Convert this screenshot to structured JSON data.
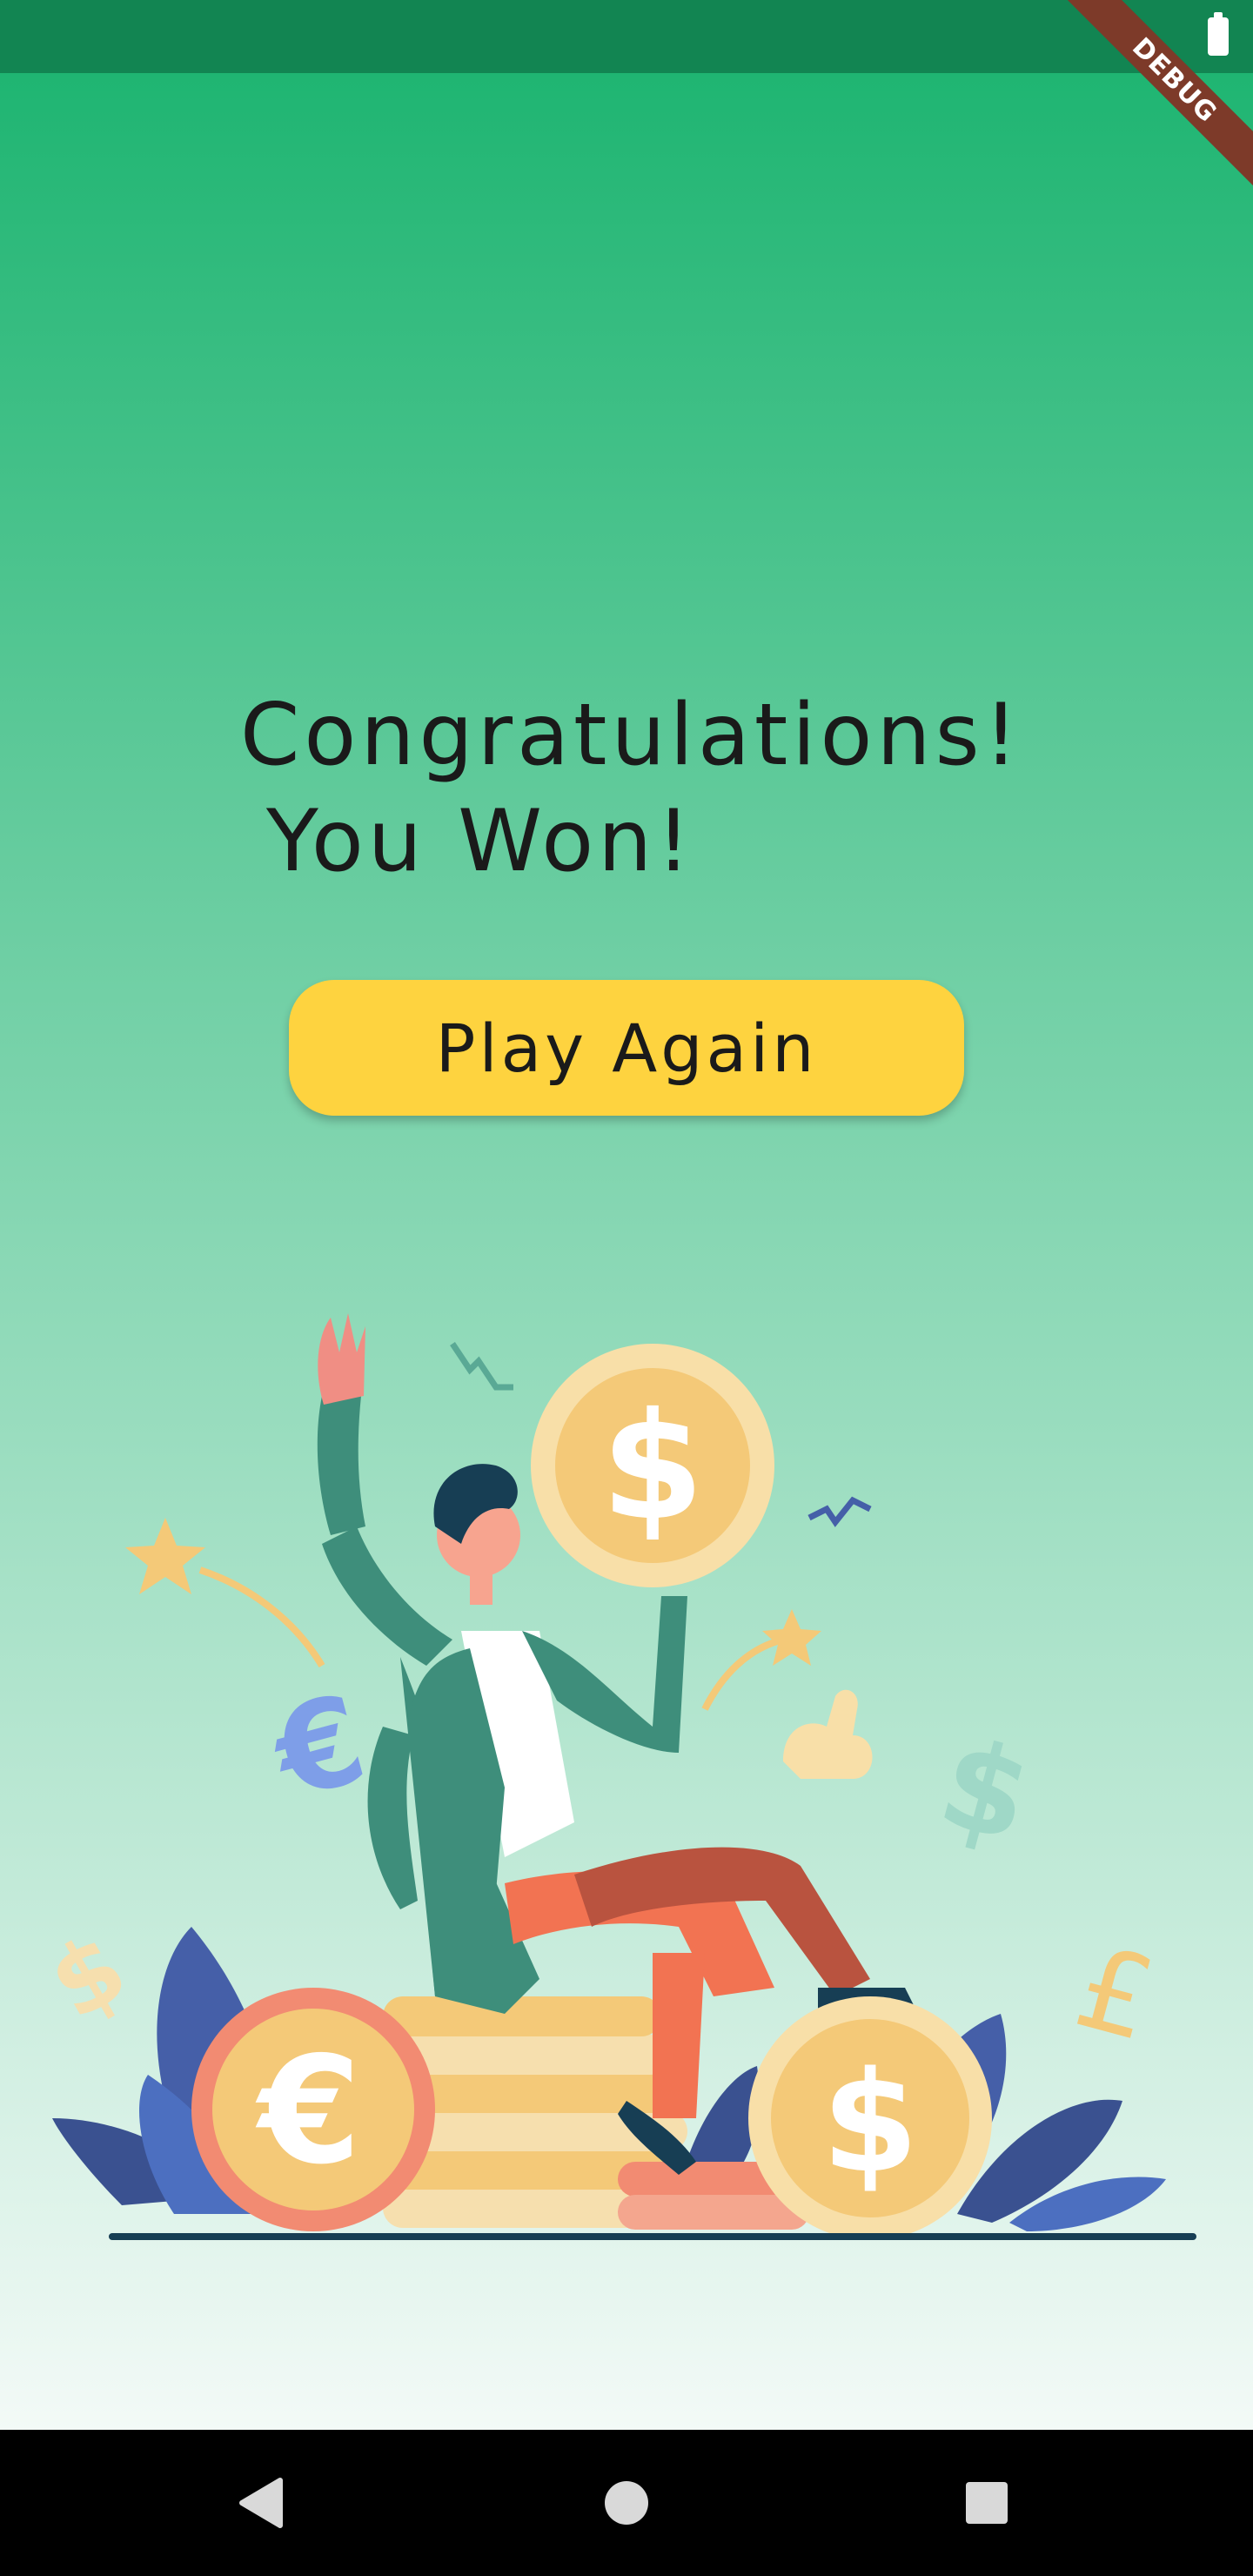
{
  "colors": {
    "status_bar": "#128552",
    "gradient_top": "#1fb572",
    "gradient_bottom": "#f3faf7",
    "text": "#1a1a1a",
    "button": "#fed33f",
    "debug_ribbon": "#7d3a29",
    "nav_bar": "#000000",
    "nav_icon": "#d9d9d9"
  },
  "status_bar": {
    "battery_icon": "battery-full-icon"
  },
  "debug_banner": {
    "label": "DEBUG"
  },
  "result": {
    "line1": "Congratulations!",
    "line2": "You Won!"
  },
  "play_again": {
    "label": "Play Again"
  },
  "illustration": {
    "subject": "man-holding-coin-on-coin-stack",
    "coin_symbols": [
      "$",
      "€",
      "$"
    ],
    "floating_symbols": [
      "€",
      "$",
      "£",
      "$"
    ]
  },
  "nav_bar": {
    "icons": [
      "back-triangle-icon",
      "home-circle-icon",
      "recents-square-icon"
    ]
  }
}
